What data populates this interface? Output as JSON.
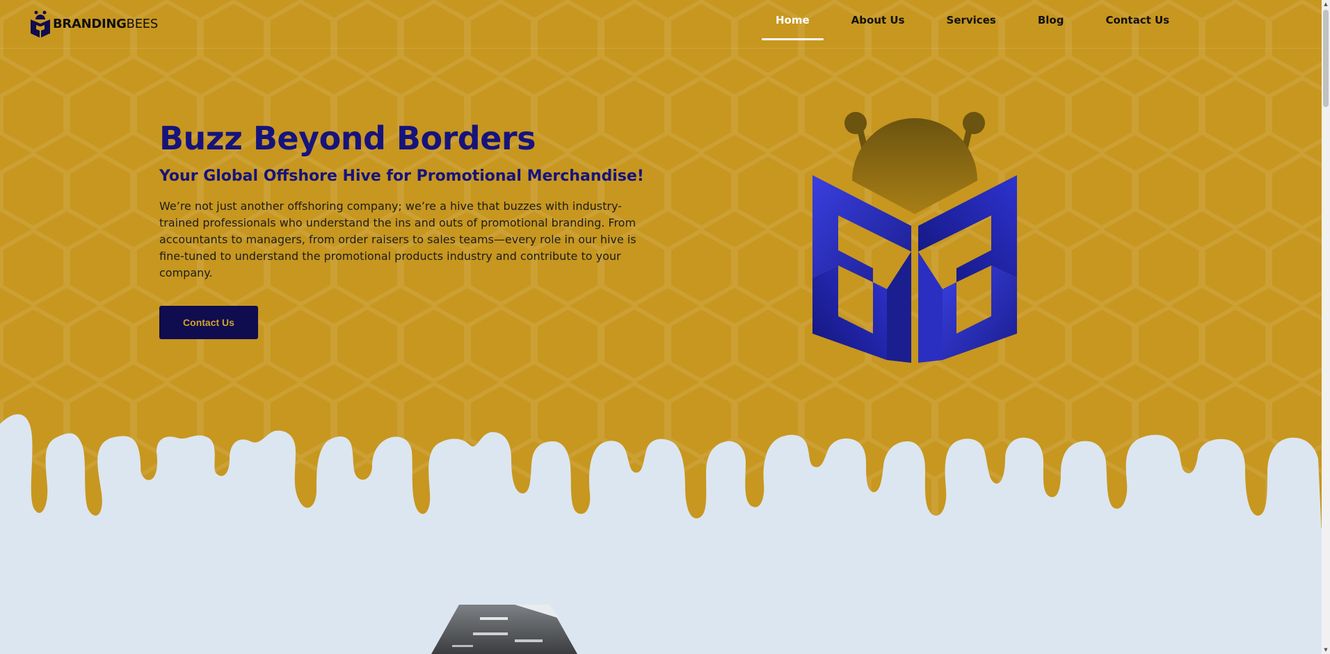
{
  "brand": {
    "name_bold": "BRANDING",
    "name_light": "BEES"
  },
  "nav": {
    "items": [
      {
        "label": "Home",
        "active": true
      },
      {
        "label": "About Us"
      },
      {
        "label": "Services"
      },
      {
        "label": "Blog"
      },
      {
        "label": "Contact Us"
      }
    ]
  },
  "hero": {
    "title": "Buzz Beyond Borders",
    "subtitle": "Your Global Offshore Hive for Promotional Merchandise!",
    "body": "We’re not just another offshoring company; we’re a hive that buzzes with industry-trained professionals who understand the ins and outs of promotional branding. From accountants to managers, from order raisers to sales teams—every role in our hive is fine-tuned to understand the promotional products industry and contribute to your company.",
    "cta_label": "Contact Us"
  },
  "colors": {
    "honey": "#c7971f",
    "navy": "#16137d",
    "button": "#0f0c4f",
    "background": "#dce6f1",
    "logo_blue": "#2a2fc2"
  },
  "icons": {
    "scroll_up": "▲",
    "scroll_down": "▼"
  }
}
